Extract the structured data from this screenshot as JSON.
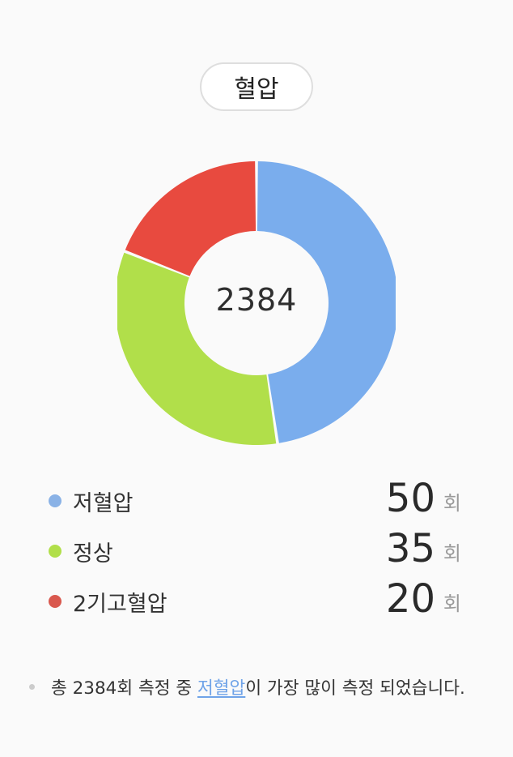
{
  "header": {
    "title": "혈압"
  },
  "chart_data": {
    "type": "pie",
    "donut": true,
    "center_label": "2384",
    "unit": "회",
    "categories": [
      "저혈압",
      "정상",
      "2기고혈압"
    ],
    "values": [
      50,
      35,
      20
    ],
    "series_colors": [
      "#7aaded",
      "#b1df4a",
      "#e84a3f"
    ],
    "legend_dot_colors": [
      "#8ab2e6",
      "#b1df4a",
      "#d9584e"
    ],
    "start_angle_deg": 0,
    "legend": "bottom"
  },
  "summary": {
    "prefix": "총 2384회 측정 중 ",
    "highlight": "저혈압",
    "suffix": "이 가장 많이 측정 되었습니다.",
    "highlight_color": "#6fa3e8"
  }
}
